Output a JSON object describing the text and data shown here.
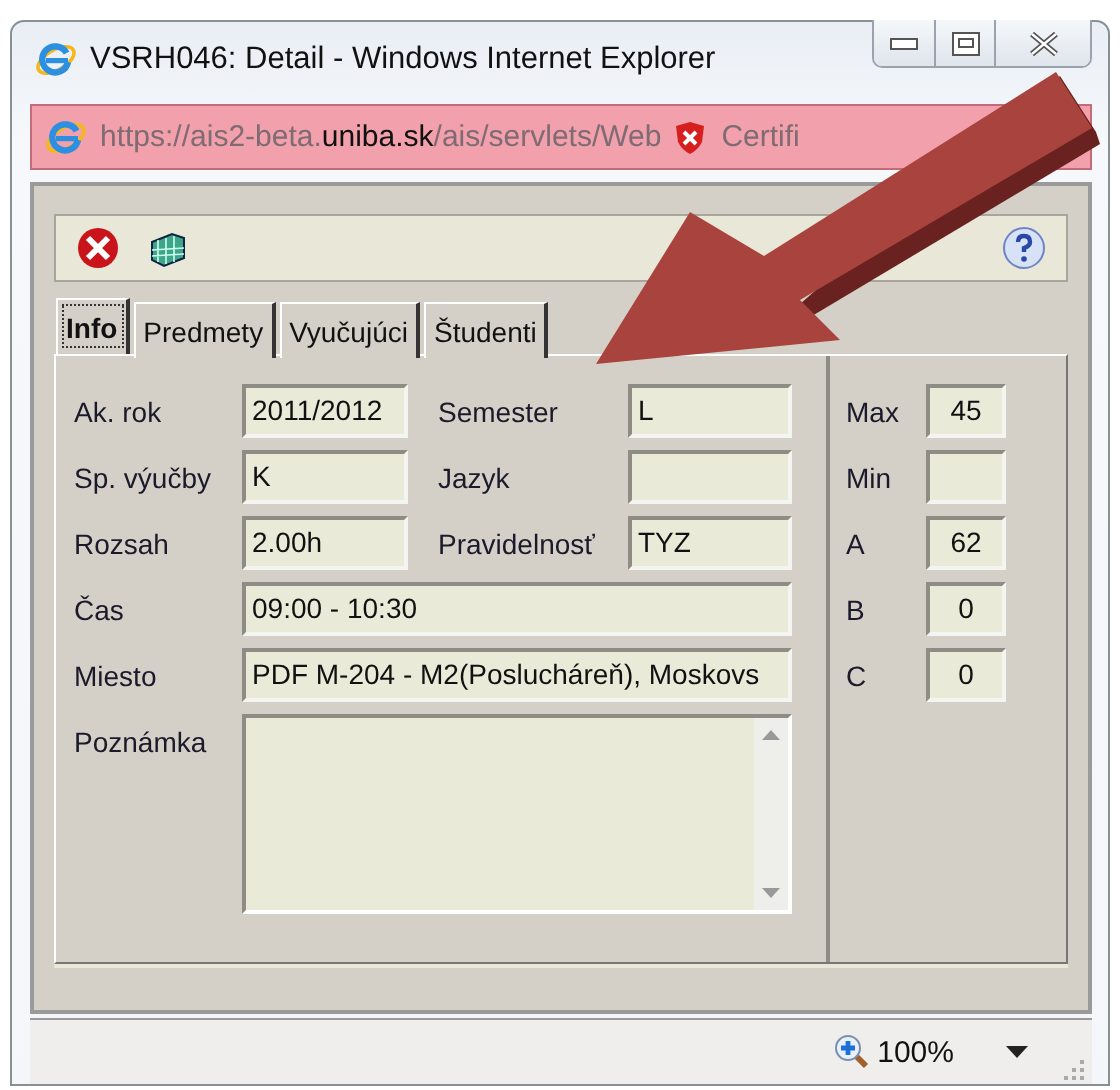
{
  "window": {
    "title": "VSRH046: Detail - Windows Internet Explorer"
  },
  "address_bar": {
    "url_start": "https://ais2-beta.",
    "url_domain": "uniba.sk",
    "url_end": "/ais/servlets/Web",
    "certificate": "Certifi"
  },
  "tabs": [
    {
      "label": "Info",
      "selected": true
    },
    {
      "label": "Predmety",
      "selected": false
    },
    {
      "label": "Vyučujúci",
      "selected": false
    },
    {
      "label": "Študenti",
      "selected": false
    }
  ],
  "form": [
    {
      "kind": "pair",
      "fields": [
        {
          "label": "Ak. rok",
          "value": "2011/2012"
        },
        {
          "label": "Semester",
          "value": "L"
        }
      ]
    },
    {
      "kind": "pair",
      "fields": [
        {
          "label": "Sp. výučby",
          "value": "K"
        },
        {
          "label": "Jazyk"
        }
      ]
    },
    {
      "kind": "pair",
      "fields": [
        {
          "label": "Rozsah",
          "value": "2.00h"
        },
        {
          "label": "Pravidelnosť",
          "value": "TYZ"
        }
      ]
    },
    {
      "kind": "wide",
      "fields": [
        {
          "label": "Čas",
          "value": "09:00 - 10:30"
        }
      ]
    },
    {
      "kind": "wide",
      "fields": [
        {
          "label": "Miesto",
          "value": "PDF M-204 - M2(Poslucháreň), Moskovs"
        }
      ]
    },
    {
      "kind": "memo",
      "fields": [
        {
          "label": "Poznámka"
        }
      ]
    }
  ],
  "counts": [
    {
      "label": "Max",
      "value": "45"
    },
    {
      "label": "Min"
    },
    {
      "label": "A",
      "value": "62"
    },
    {
      "label": "B",
      "value": "0"
    },
    {
      "label": "C",
      "value": "0"
    }
  ],
  "status_bar": {
    "zoom": "100%"
  }
}
